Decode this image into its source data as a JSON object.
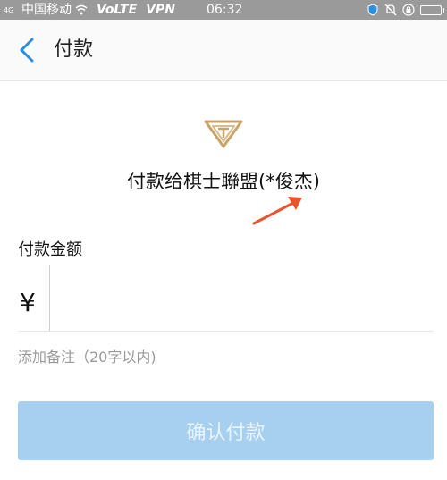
{
  "status_bar": {
    "signal_label": "4G",
    "carrier": "中国移动",
    "volte": "VoLTE",
    "vpn": "VPN",
    "time": "06:32"
  },
  "header": {
    "title": "付款"
  },
  "payee": {
    "text": "付款给棋士聯盟(*俊杰)"
  },
  "amount": {
    "label": "付款金额",
    "currency_symbol": "¥",
    "value": ""
  },
  "remark": {
    "label": "添加备注（20字以内)"
  },
  "confirm": {
    "label": "确认付款"
  },
  "colors": {
    "accent": "#2b8fe0",
    "confirm_disabled": "#a7d0f0",
    "arrow": "#e8552d",
    "logo_gold": "#c9a46a"
  }
}
